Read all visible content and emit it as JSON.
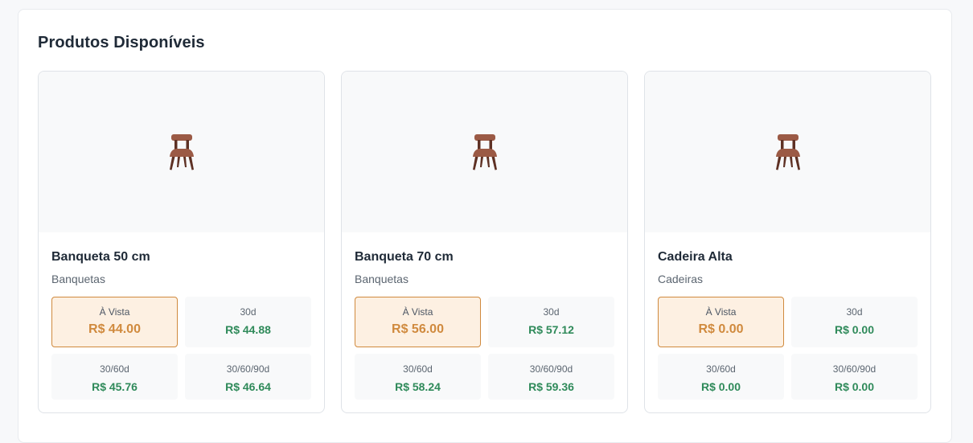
{
  "section": {
    "title": "Produtos Disponíveis"
  },
  "icons": {
    "product_image": "chair-icon"
  },
  "colors": {
    "selected_border": "#d08a3e",
    "selected_background": "#fdf0e2",
    "price_green": "#2f8a5a",
    "chair_brown": "#9b5a45"
  },
  "products": [
    {
      "name": "Banqueta 50 cm",
      "category": "Banquetas",
      "prices": [
        {
          "label": "À Vista",
          "value": "R$ 44.00",
          "selected": true
        },
        {
          "label": "30d",
          "value": "R$ 44.88",
          "selected": false
        },
        {
          "label": "30/60d",
          "value": "R$ 45.76",
          "selected": false
        },
        {
          "label": "30/60/90d",
          "value": "R$ 46.64",
          "selected": false
        }
      ]
    },
    {
      "name": "Banqueta 70 cm",
      "category": "Banquetas",
      "prices": [
        {
          "label": "À Vista",
          "value": "R$ 56.00",
          "selected": true
        },
        {
          "label": "30d",
          "value": "R$ 57.12",
          "selected": false
        },
        {
          "label": "30/60d",
          "value": "R$ 58.24",
          "selected": false
        },
        {
          "label": "30/60/90d",
          "value": "R$ 59.36",
          "selected": false
        }
      ]
    },
    {
      "name": "Cadeira Alta",
      "category": "Cadeiras",
      "prices": [
        {
          "label": "À Vista",
          "value": "R$ 0.00",
          "selected": true
        },
        {
          "label": "30d",
          "value": "R$ 0.00",
          "selected": false
        },
        {
          "label": "30/60d",
          "value": "R$ 0.00",
          "selected": false
        },
        {
          "label": "30/60/90d",
          "value": "R$ 0.00",
          "selected": false
        }
      ]
    }
  ]
}
